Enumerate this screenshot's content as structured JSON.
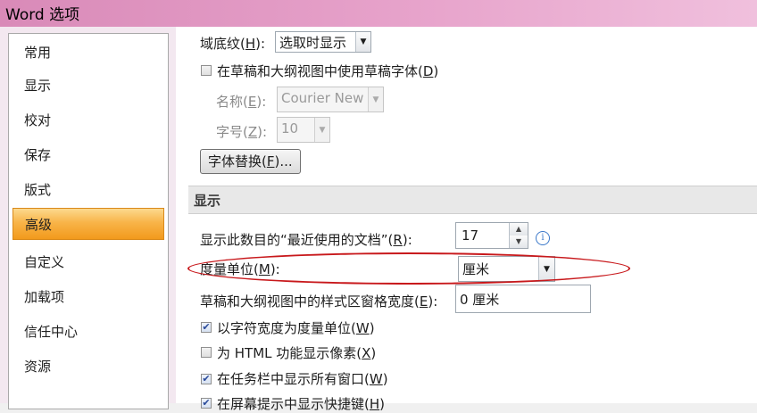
{
  "window": {
    "title": "Word 选项"
  },
  "sidebar": {
    "items": [
      {
        "label": "常用"
      },
      {
        "label": "显示"
      },
      {
        "label": "校对"
      },
      {
        "label": "保存"
      },
      {
        "label": "版式"
      },
      {
        "label": "高级",
        "active": true
      },
      {
        "label": "自定义"
      },
      {
        "label": "加载项"
      },
      {
        "label": "信任中心"
      },
      {
        "label": "资源"
      }
    ]
  },
  "draft": {
    "field_shading_label": "域底纹(",
    "field_shading_key": "H",
    "field_shading_suffix": "):",
    "field_shading_value": "选取时显示",
    "use_draft_font_label": "在草稿和大纲视图中使用草稿字体(",
    "use_draft_font_key": "D",
    "use_draft_font_suffix": ")",
    "use_draft_font_checked": false,
    "name_label": "名称(",
    "name_key": "E",
    "name_suffix": "):",
    "name_value": "Courier New",
    "size_label": "字号(",
    "size_key": "Z",
    "size_suffix": "):",
    "size_value": "10",
    "font_sub_label": "字体替换(",
    "font_sub_key": "F",
    "font_sub_suffix": ")..."
  },
  "display": {
    "section_title": "显示",
    "recent_docs_label": "显示此数目的“最近使用的文档”(",
    "recent_docs_key": "R",
    "recent_docs_suffix": "):",
    "recent_docs_value": "17",
    "units_label": "度量单位(",
    "units_key": "M",
    "units_suffix": "):",
    "units_value": "厘米",
    "style_area_label": "草稿和大纲视图中的样式区窗格宽度(",
    "style_area_key": "E",
    "style_area_suffix": "):",
    "style_area_value": "0 厘米",
    "char_width_label": "以字符宽度为度量单位(",
    "char_width_key": "W",
    "char_width_suffix": ")",
    "char_width_checked": true,
    "html_pixels_label": "为 HTML 功能显示像素(",
    "html_pixels_key": "X",
    "html_pixels_suffix": ")",
    "html_pixels_checked": false,
    "taskbar_label": "在任务栏中显示所有窗口(",
    "taskbar_key": "W",
    "taskbar_suffix": ")",
    "taskbar_checked": true,
    "shortcut_label": "在屏幕提示中显示快捷键(",
    "shortcut_key": "H",
    "shortcut_suffix": ")",
    "shortcut_checked": true
  },
  "icons": {
    "info": "info-icon",
    "dropdown": "chevron-down-icon",
    "spin_up": "spin-up-icon",
    "spin_down": "spin-down-icon"
  },
  "colors": {
    "active_item": "#f8b449",
    "annotation": "#c8191c",
    "title_bar": "#e7a3cb"
  }
}
